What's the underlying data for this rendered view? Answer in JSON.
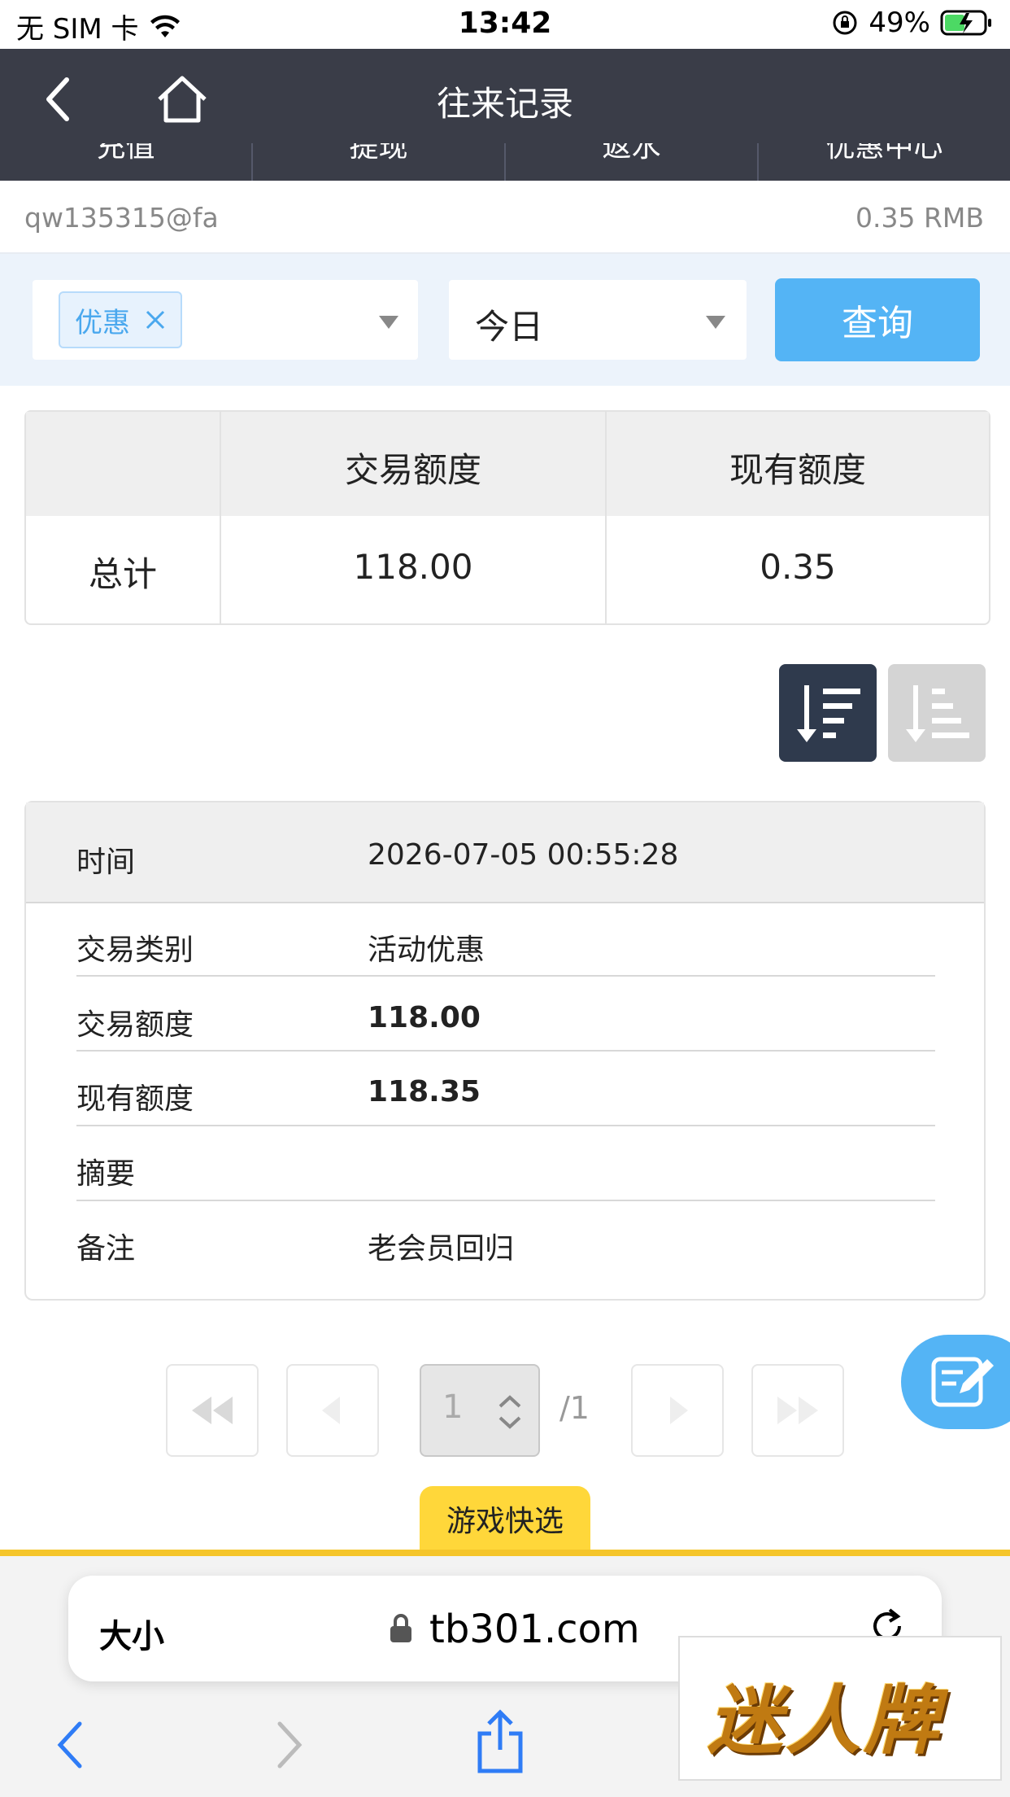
{
  "status_bar": {
    "carrier": "无 SIM 卡",
    "time": "13:42",
    "battery_pct": "49%"
  },
  "header": {
    "title": "往来记录",
    "tabs": [
      "充值",
      "提现",
      "返水",
      "优惠中心"
    ]
  },
  "account": {
    "username": "qw135315@fa",
    "balance": "0.35 RMB"
  },
  "filter": {
    "type_chip": "优惠",
    "date_range": "今日",
    "query_label": "查询"
  },
  "summary": {
    "col_trade": "交易额度",
    "col_current": "现有额度",
    "row_label": "总计",
    "trade_value": "118.00",
    "current_value": "0.35"
  },
  "record": {
    "time_label": "时间",
    "time_value": "2026-07-05 00:55:28",
    "type_label": "交易类别",
    "type_value": "活动优惠",
    "amount_label": "交易额度",
    "amount_value": "118.00",
    "balance_label": "现有额度",
    "balance_value": "118.35",
    "summary_label": "摘要",
    "summary_value": "",
    "note_label": "备注",
    "note_value": "老会员回归"
  },
  "pagination": {
    "current_page": "1",
    "total_pages": "/1"
  },
  "bottom": {
    "game_tab": "游戏快选"
  },
  "browser": {
    "text_size": "大小",
    "url": "tb301.com"
  },
  "logo": {
    "text": "迷人牌"
  },
  "colors": {
    "header_bg": "#3a3d48",
    "accent_blue": "#54b4f5",
    "yellow": "#ffd73a"
  }
}
